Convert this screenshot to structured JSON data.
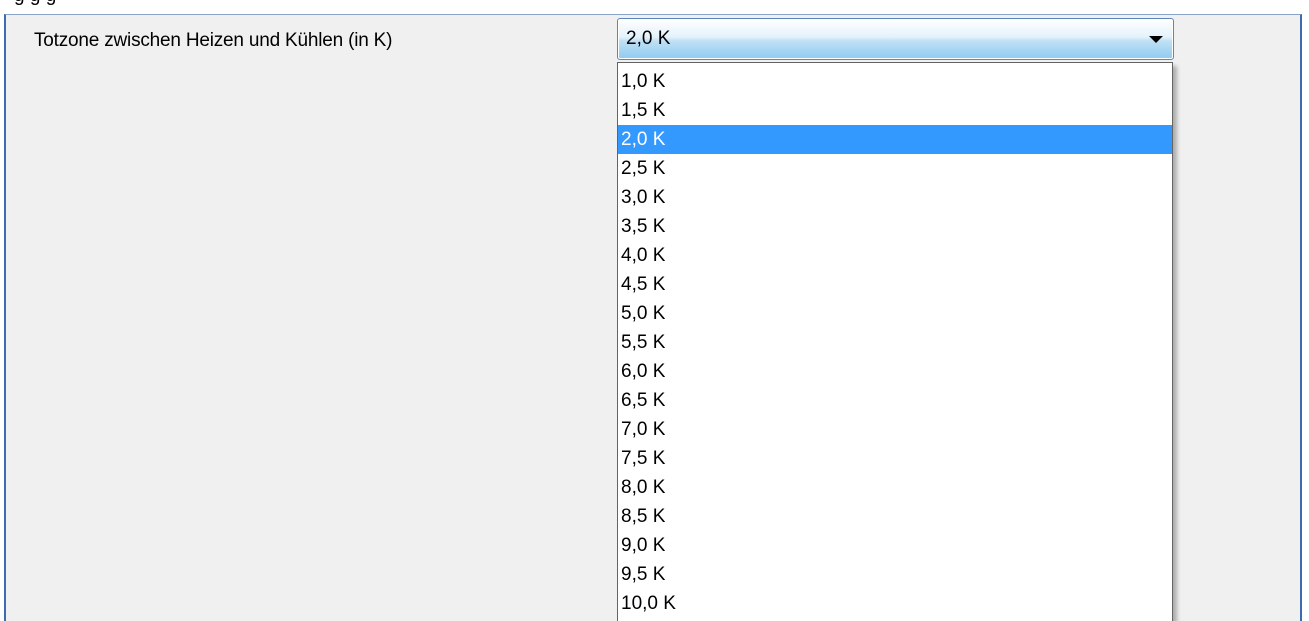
{
  "parameter": {
    "label": "Totzone zwischen Heizen und Kühlen (in K)",
    "selected_value": "2,0 K",
    "selected_index": 2
  },
  "dropdown": {
    "options": [
      "1,0 K",
      "1,5 K",
      "2,0 K",
      "2,5 K",
      "3,0 K",
      "3,5 K",
      "4,0 K",
      "4,5 K",
      "5,0 K",
      "5,5 K",
      "6,0 K",
      "6,5 K",
      "7,0 K",
      "7,5 K",
      "8,0 K",
      "8,5 K",
      "9,0 K",
      "9,5 K",
      "10,0 K"
    ]
  },
  "colors": {
    "selection": "#3399ff",
    "panel_background": "#f0f0f0",
    "panel_border": "#3c6bb0"
  }
}
